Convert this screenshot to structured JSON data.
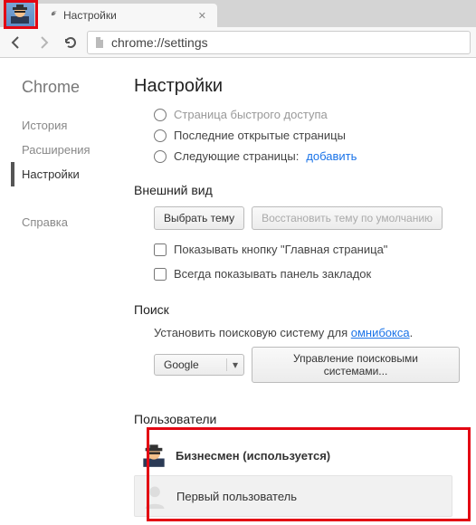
{
  "tab": {
    "title": "Настройки"
  },
  "toolbar": {
    "url": "chrome://settings"
  },
  "sidebar": {
    "brand": "Chrome",
    "items": [
      "История",
      "Расширения",
      "Настройки"
    ],
    "help": "Справка",
    "active_index": 2
  },
  "main": {
    "title": "Настройки",
    "startup": {
      "opt0": "Страница быстрого доступа",
      "opt1": "Последние открытые страницы",
      "opt2_prefix": "Следующие страницы:",
      "opt2_link": "добавить"
    },
    "appearance": {
      "title": "Внешний вид",
      "choose_theme": "Выбрать тему",
      "reset_theme": "Восстановить тему по умолчанию",
      "show_home": "Показывать кнопку \"Главная страница\"",
      "show_bookmarks": "Всегда показывать панель закладок"
    },
    "search": {
      "title": "Поиск",
      "text_prefix": "Установить поисковую систему для ",
      "omnibox_link": "омнибокса",
      "text_suffix": ".",
      "engine": "Google",
      "manage": "Управление поисковыми системами..."
    },
    "users": {
      "title": "Пользователи",
      "current": "Бизнесмен (используется)",
      "other": "Первый пользователь"
    }
  }
}
